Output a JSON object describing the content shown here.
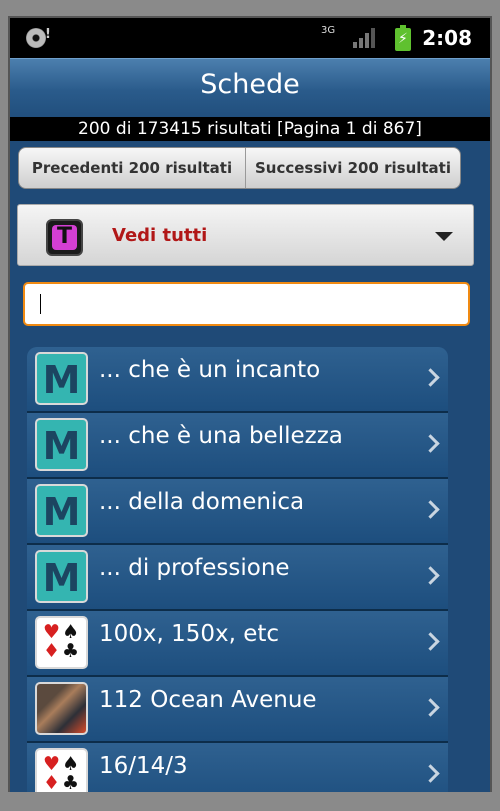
{
  "status_bar": {
    "network_label": "3G",
    "time": "2:08",
    "battery_color": "#5fc12f"
  },
  "header": {
    "title": "Schede"
  },
  "results_info": "200 di 173415 risultati [Pagina 1 di 867]",
  "pager": {
    "prev_label": "Precedenti 200 risultati",
    "next_label": "Successivi 200 risultati"
  },
  "filter": {
    "icon_letter": "T",
    "selected_label": "Vedi tutti"
  },
  "search": {
    "value": "",
    "placeholder": ""
  },
  "items": [
    {
      "label": "... che è un incanto",
      "icon": "M"
    },
    {
      "label": "... che è una bellezza",
      "icon": "M"
    },
    {
      "label": "... della domenica",
      "icon": "M"
    },
    {
      "label": "... di professione",
      "icon": "M"
    },
    {
      "label": "100x, 150x, etc",
      "icon": "cards-icon"
    },
    {
      "label": "112 Ocean Avenue",
      "icon": "ocean-avenue-icon"
    },
    {
      "label": "16/14/3",
      "icon": "cards-icon"
    }
  ]
}
